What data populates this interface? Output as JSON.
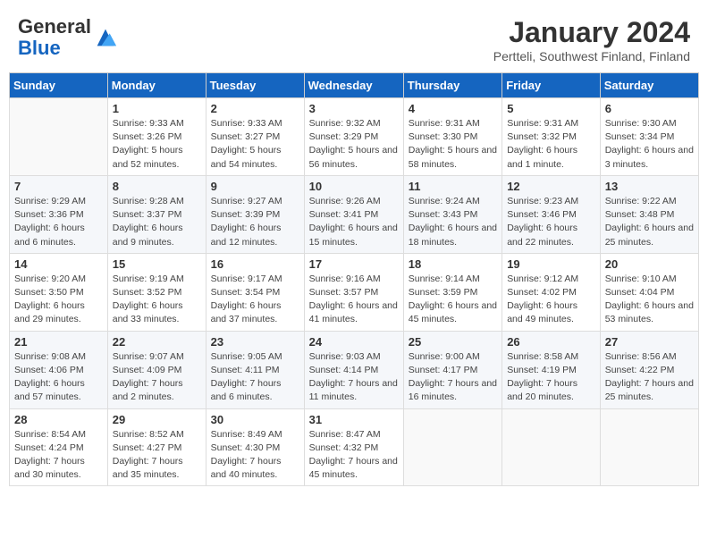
{
  "header": {
    "logo_general": "General",
    "logo_blue": "Blue",
    "month_title": "January 2024",
    "location": "Pertteli, Southwest Finland, Finland"
  },
  "days_of_week": [
    "Sunday",
    "Monday",
    "Tuesday",
    "Wednesday",
    "Thursday",
    "Friday",
    "Saturday"
  ],
  "weeks": [
    [
      {
        "day": "",
        "sunrise": "",
        "sunset": "",
        "daylight": ""
      },
      {
        "day": "1",
        "sunrise": "Sunrise: 9:33 AM",
        "sunset": "Sunset: 3:26 PM",
        "daylight": "Daylight: 5 hours and 52 minutes."
      },
      {
        "day": "2",
        "sunrise": "Sunrise: 9:33 AM",
        "sunset": "Sunset: 3:27 PM",
        "daylight": "Daylight: 5 hours and 54 minutes."
      },
      {
        "day": "3",
        "sunrise": "Sunrise: 9:32 AM",
        "sunset": "Sunset: 3:29 PM",
        "daylight": "Daylight: 5 hours and 56 minutes."
      },
      {
        "day": "4",
        "sunrise": "Sunrise: 9:31 AM",
        "sunset": "Sunset: 3:30 PM",
        "daylight": "Daylight: 5 hours and 58 minutes."
      },
      {
        "day": "5",
        "sunrise": "Sunrise: 9:31 AM",
        "sunset": "Sunset: 3:32 PM",
        "daylight": "Daylight: 6 hours and 1 minute."
      },
      {
        "day": "6",
        "sunrise": "Sunrise: 9:30 AM",
        "sunset": "Sunset: 3:34 PM",
        "daylight": "Daylight: 6 hours and 3 minutes."
      }
    ],
    [
      {
        "day": "7",
        "sunrise": "Sunrise: 9:29 AM",
        "sunset": "Sunset: 3:36 PM",
        "daylight": "Daylight: 6 hours and 6 minutes."
      },
      {
        "day": "8",
        "sunrise": "Sunrise: 9:28 AM",
        "sunset": "Sunset: 3:37 PM",
        "daylight": "Daylight: 6 hours and 9 minutes."
      },
      {
        "day": "9",
        "sunrise": "Sunrise: 9:27 AM",
        "sunset": "Sunset: 3:39 PM",
        "daylight": "Daylight: 6 hours and 12 minutes."
      },
      {
        "day": "10",
        "sunrise": "Sunrise: 9:26 AM",
        "sunset": "Sunset: 3:41 PM",
        "daylight": "Daylight: 6 hours and 15 minutes."
      },
      {
        "day": "11",
        "sunrise": "Sunrise: 9:24 AM",
        "sunset": "Sunset: 3:43 PM",
        "daylight": "Daylight: 6 hours and 18 minutes."
      },
      {
        "day": "12",
        "sunrise": "Sunrise: 9:23 AM",
        "sunset": "Sunset: 3:46 PM",
        "daylight": "Daylight: 6 hours and 22 minutes."
      },
      {
        "day": "13",
        "sunrise": "Sunrise: 9:22 AM",
        "sunset": "Sunset: 3:48 PM",
        "daylight": "Daylight: 6 hours and 25 minutes."
      }
    ],
    [
      {
        "day": "14",
        "sunrise": "Sunrise: 9:20 AM",
        "sunset": "Sunset: 3:50 PM",
        "daylight": "Daylight: 6 hours and 29 minutes."
      },
      {
        "day": "15",
        "sunrise": "Sunrise: 9:19 AM",
        "sunset": "Sunset: 3:52 PM",
        "daylight": "Daylight: 6 hours and 33 minutes."
      },
      {
        "day": "16",
        "sunrise": "Sunrise: 9:17 AM",
        "sunset": "Sunset: 3:54 PM",
        "daylight": "Daylight: 6 hours and 37 minutes."
      },
      {
        "day": "17",
        "sunrise": "Sunrise: 9:16 AM",
        "sunset": "Sunset: 3:57 PM",
        "daylight": "Daylight: 6 hours and 41 minutes."
      },
      {
        "day": "18",
        "sunrise": "Sunrise: 9:14 AM",
        "sunset": "Sunset: 3:59 PM",
        "daylight": "Daylight: 6 hours and 45 minutes."
      },
      {
        "day": "19",
        "sunrise": "Sunrise: 9:12 AM",
        "sunset": "Sunset: 4:02 PM",
        "daylight": "Daylight: 6 hours and 49 minutes."
      },
      {
        "day": "20",
        "sunrise": "Sunrise: 9:10 AM",
        "sunset": "Sunset: 4:04 PM",
        "daylight": "Daylight: 6 hours and 53 minutes."
      }
    ],
    [
      {
        "day": "21",
        "sunrise": "Sunrise: 9:08 AM",
        "sunset": "Sunset: 4:06 PM",
        "daylight": "Daylight: 6 hours and 57 minutes."
      },
      {
        "day": "22",
        "sunrise": "Sunrise: 9:07 AM",
        "sunset": "Sunset: 4:09 PM",
        "daylight": "Daylight: 7 hours and 2 minutes."
      },
      {
        "day": "23",
        "sunrise": "Sunrise: 9:05 AM",
        "sunset": "Sunset: 4:11 PM",
        "daylight": "Daylight: 7 hours and 6 minutes."
      },
      {
        "day": "24",
        "sunrise": "Sunrise: 9:03 AM",
        "sunset": "Sunset: 4:14 PM",
        "daylight": "Daylight: 7 hours and 11 minutes."
      },
      {
        "day": "25",
        "sunrise": "Sunrise: 9:00 AM",
        "sunset": "Sunset: 4:17 PM",
        "daylight": "Daylight: 7 hours and 16 minutes."
      },
      {
        "day": "26",
        "sunrise": "Sunrise: 8:58 AM",
        "sunset": "Sunset: 4:19 PM",
        "daylight": "Daylight: 7 hours and 20 minutes."
      },
      {
        "day": "27",
        "sunrise": "Sunrise: 8:56 AM",
        "sunset": "Sunset: 4:22 PM",
        "daylight": "Daylight: 7 hours and 25 minutes."
      }
    ],
    [
      {
        "day": "28",
        "sunrise": "Sunrise: 8:54 AM",
        "sunset": "Sunset: 4:24 PM",
        "daylight": "Daylight: 7 hours and 30 minutes."
      },
      {
        "day": "29",
        "sunrise": "Sunrise: 8:52 AM",
        "sunset": "Sunset: 4:27 PM",
        "daylight": "Daylight: 7 hours and 35 minutes."
      },
      {
        "day": "30",
        "sunrise": "Sunrise: 8:49 AM",
        "sunset": "Sunset: 4:30 PM",
        "daylight": "Daylight: 7 hours and 40 minutes."
      },
      {
        "day": "31",
        "sunrise": "Sunrise: 8:47 AM",
        "sunset": "Sunset: 4:32 PM",
        "daylight": "Daylight: 7 hours and 45 minutes."
      },
      {
        "day": "",
        "sunrise": "",
        "sunset": "",
        "daylight": ""
      },
      {
        "day": "",
        "sunrise": "",
        "sunset": "",
        "daylight": ""
      },
      {
        "day": "",
        "sunrise": "",
        "sunset": "",
        "daylight": ""
      }
    ]
  ]
}
